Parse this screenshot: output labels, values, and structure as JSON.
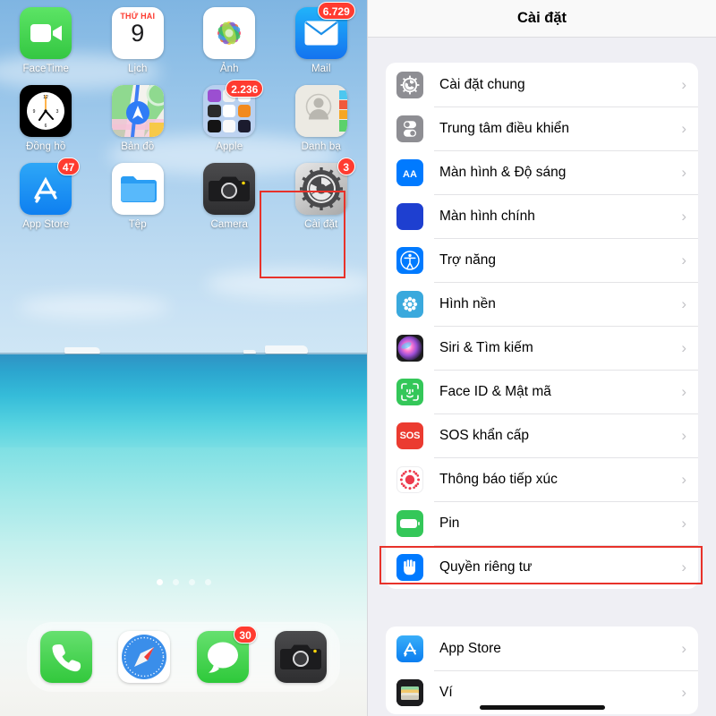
{
  "home_screen": {
    "apps": [
      {
        "name": "FaceTime",
        "label": "FaceTime",
        "icon": "facetime-icon",
        "badge": null
      },
      {
        "name": "Calendar",
        "label": "Lịch",
        "icon": "calendar-icon",
        "badge": null,
        "weekday": "THỨ HAI",
        "day": "9"
      },
      {
        "name": "Photos",
        "label": "Ảnh",
        "icon": "photos-icon",
        "badge": null
      },
      {
        "name": "Mail",
        "label": "Mail",
        "icon": "mail-icon",
        "badge": "6.729"
      },
      {
        "name": "Clock",
        "label": "Đồng hồ",
        "icon": "clock-icon",
        "badge": null
      },
      {
        "name": "Maps",
        "label": "Bản đồ",
        "icon": "maps-icon",
        "badge": null
      },
      {
        "name": "Apple",
        "label": "Apple",
        "icon": "folder-icon",
        "badge": "2.236"
      },
      {
        "name": "Contacts",
        "label": "Danh bạ",
        "icon": "contacts-icon",
        "badge": null
      },
      {
        "name": "App Store",
        "label": "App Store",
        "icon": "appstore-icon",
        "badge": "47"
      },
      {
        "name": "Files",
        "label": "Tệp",
        "icon": "files-icon",
        "badge": null
      },
      {
        "name": "Camera",
        "label": "Camera",
        "icon": "camera-icon",
        "badge": null
      },
      {
        "name": "Settings",
        "label": "Cài đặt",
        "icon": "settings-gear-icon",
        "badge": "3",
        "highlighted": true
      }
    ],
    "page_dots": {
      "count": 4,
      "active_index": 0
    },
    "dock": [
      {
        "name": "Phone",
        "icon": "phone-icon",
        "badge": null
      },
      {
        "name": "Safari",
        "icon": "safari-compass-icon",
        "badge": null
      },
      {
        "name": "Messages",
        "icon": "messages-bubble-icon",
        "badge": "30"
      },
      {
        "name": "Camera",
        "icon": "camera-icon",
        "badge": null
      }
    ]
  },
  "settings_screen": {
    "nav_title": "Cài đặt",
    "chevron": "›",
    "group_one": [
      {
        "label": "Cài đặt chung",
        "icon": "gear-icon"
      },
      {
        "label": "Trung tâm điều khiển",
        "icon": "control-center-icon"
      },
      {
        "label": "Màn hình & Độ sáng",
        "icon": "display-brightness-icon",
        "glyph": "AA"
      },
      {
        "label": "Màn hình chính",
        "icon": "home-screen-icon"
      },
      {
        "label": "Trợ năng",
        "icon": "accessibility-icon"
      },
      {
        "label": "Hình nền",
        "icon": "wallpaper-icon"
      },
      {
        "label": "Siri & Tìm kiếm",
        "icon": "siri-icon"
      },
      {
        "label": "Face ID & Mật mã",
        "icon": "faceid-icon"
      },
      {
        "label": "SOS khẩn cấp",
        "icon": "sos-icon",
        "glyph": "SOS"
      },
      {
        "label": "Thông báo tiếp xúc",
        "icon": "exposure-notification-icon"
      },
      {
        "label": "Pin",
        "icon": "battery-icon"
      },
      {
        "label": "Quyền riêng tư",
        "icon": "privacy-hand-icon",
        "highlighted": true
      }
    ],
    "group_two": [
      {
        "label": "App Store",
        "icon": "appstore-icon"
      },
      {
        "label": "Ví",
        "icon": "wallet-icon"
      }
    ]
  },
  "annotations": {
    "highlight_color": "#e8322a",
    "targets": [
      "Cài đặt (home icon)",
      "Quyền riêng tư (settings row)"
    ]
  }
}
